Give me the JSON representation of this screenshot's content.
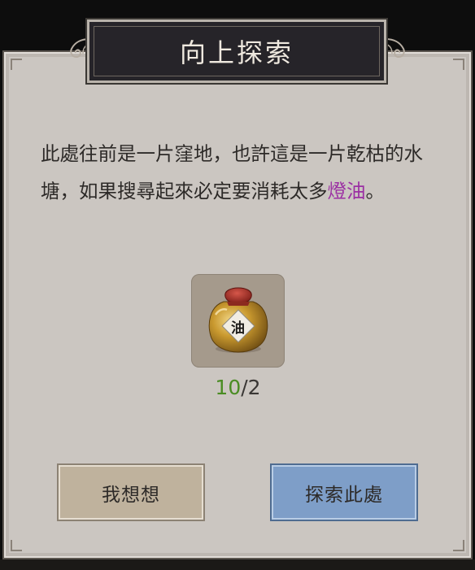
{
  "dialog": {
    "title": "向上探索",
    "message_before": "此處往前是一片窪地，也許這是一片乾枯的水塘，如果搜尋起來必定要消耗太多",
    "message_highlight": "燈油",
    "message_after": "。",
    "highlight_color": "#9b2fa3"
  },
  "item": {
    "icon": "oil-jar-icon",
    "jar_label": "油",
    "count_have": "10",
    "count_separator": "/",
    "count_need": "2",
    "have_color": "#4a8c23"
  },
  "buttons": {
    "think_label": "我想想",
    "explore_label": "探索此處"
  }
}
